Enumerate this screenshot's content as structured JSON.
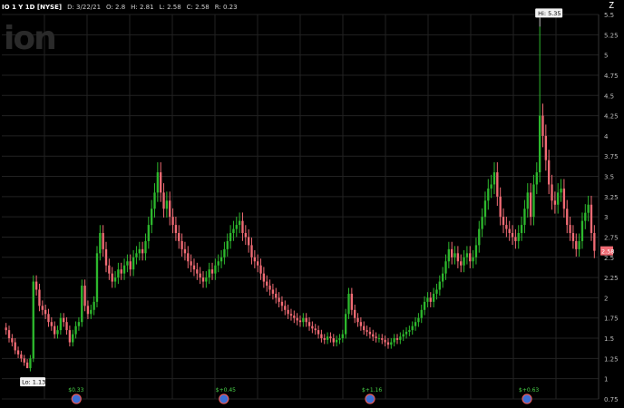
{
  "header": {
    "symbol": "IO 1 Y 1D [NYSE]",
    "date": "D: 3/22/21",
    "open": "O: 2.8",
    "high": "H: 2.81",
    "low": "L: 2.58",
    "close": "C: 2.58",
    "range": "R: 0.23"
  },
  "watermark": "ion",
  "corner_icon": "zoom-icon",
  "corner_glyph": "Z",
  "colors": {
    "up": "#2db82d",
    "down": "#f06b74",
    "background": "#000000",
    "grid": "#222222",
    "price_tag": "#f06b74"
  },
  "chart_data": {
    "type": "candlestick",
    "title": "",
    "xlabel": "",
    "ylabel": "",
    "ylim": [
      0.75,
      5.5
    ],
    "y_ticks": [
      "0.75",
      "1",
      "1.25",
      "1.5",
      "1.75",
      "2",
      "2.25",
      "2.5",
      "2.75",
      "3",
      "3.25",
      "3.5",
      "3.75",
      "4",
      "4.25",
      "4.5",
      "4.75",
      "5",
      "5.25",
      "5.5"
    ],
    "grid": true,
    "last_price": "2.58",
    "high_annotation": "Hi: 5.35",
    "low_annotation": "Lo: 1.13",
    "dividend_markers": [
      {
        "label": "$0.33",
        "pos": 0.125
      },
      {
        "label": "$+0.45",
        "pos": 0.372
      },
      {
        "label": "$+1.16",
        "pos": 0.617
      },
      {
        "label": "$+0.63",
        "pos": 0.88
      }
    ],
    "close_series": [
      1.6,
      1.5,
      1.45,
      1.35,
      1.3,
      1.25,
      1.2,
      1.13,
      1.25,
      2.2,
      2.1,
      1.9,
      1.85,
      1.8,
      1.7,
      1.65,
      1.55,
      1.6,
      1.75,
      1.7,
      1.6,
      1.45,
      1.55,
      1.65,
      1.7,
      2.15,
      1.9,
      1.8,
      1.85,
      1.95,
      2.55,
      2.8,
      2.6,
      2.4,
      2.3,
      2.2,
      2.25,
      2.35,
      2.3,
      2.4,
      2.45,
      2.35,
      2.5,
      2.55,
      2.6,
      2.55,
      2.7,
      2.9,
      3.1,
      3.3,
      3.55,
      3.3,
      3.1,
      3.2,
      3.0,
      2.9,
      2.8,
      2.7,
      2.6,
      2.55,
      2.45,
      2.4,
      2.35,
      2.3,
      2.25,
      2.2,
      2.25,
      2.35,
      2.3,
      2.4,
      2.45,
      2.5,
      2.6,
      2.7,
      2.8,
      2.85,
      2.9,
      2.95,
      2.8,
      2.75,
      2.65,
      2.5,
      2.45,
      2.4,
      2.3,
      2.2,
      2.15,
      2.1,
      2.05,
      2.0,
      1.95,
      1.9,
      1.85,
      1.8,
      1.78,
      1.75,
      1.72,
      1.7,
      1.75,
      1.7,
      1.65,
      1.62,
      1.6,
      1.55,
      1.5,
      1.48,
      1.52,
      1.5,
      1.45,
      1.48,
      1.5,
      1.55,
      1.8,
      2.05,
      1.85,
      1.75,
      1.7,
      1.65,
      1.6,
      1.58,
      1.55,
      1.52,
      1.5,
      1.5,
      1.48,
      1.45,
      1.42,
      1.45,
      1.5,
      1.48,
      1.52,
      1.55,
      1.58,
      1.6,
      1.65,
      1.7,
      1.75,
      1.85,
      1.95,
      2.0,
      1.95,
      2.05,
      2.1,
      2.2,
      2.3,
      2.45,
      2.6,
      2.5,
      2.55,
      2.45,
      2.4,
      2.5,
      2.55,
      2.45,
      2.5,
      2.65,
      2.85,
      3.0,
      3.2,
      3.35,
      3.4,
      3.55,
      3.25,
      3.0,
      2.9,
      2.85,
      2.8,
      2.75,
      2.7,
      2.8,
      2.9,
      3.1,
      3.3,
      3.0,
      3.4,
      3.55,
      4.25,
      4.0,
      3.7,
      3.4,
      3.2,
      3.15,
      3.3,
      3.35,
      3.1,
      2.9,
      2.8,
      2.7,
      2.6,
      2.7,
      2.95,
      3.05,
      3.15,
      2.8,
      2.58
    ]
  }
}
